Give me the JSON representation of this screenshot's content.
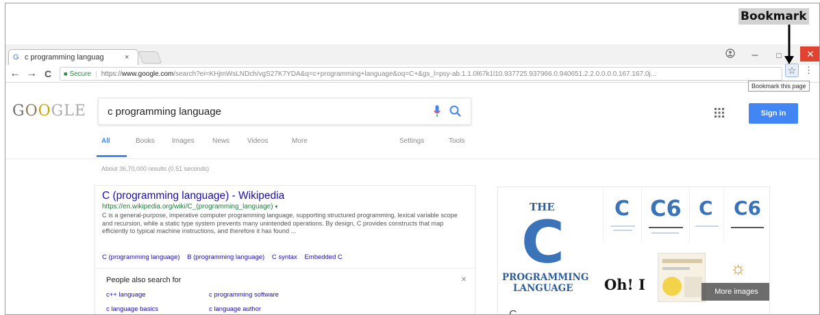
{
  "annotation": {
    "label": "Bookmark"
  },
  "browser": {
    "tab_title": "c programming languag",
    "tab_close": "×",
    "nav": {
      "back": "←",
      "forward": "→",
      "reload": "C"
    },
    "omnibox": {
      "secure_label": "Secure",
      "url_scheme": "https://",
      "url_host": "www.google.com",
      "url_rest": "/search?ei=KHjmWsLNDch/vgS27K7YDA&q=c+programming+language&oq=C+&gs_l=psy-ab.1.1.0l67k1l10.937725.937966.0.940651.2.2.0.0.0.0.167.167.0j..."
    },
    "tooltip": "Bookmark this page",
    "window_controls": {
      "minimize": "–",
      "maximize": "□",
      "close": "✕"
    },
    "profile_icon": "profile-icon"
  },
  "google": {
    "logo_text": "GOOGLE",
    "query": "c programming language",
    "signin_label": "Sign in",
    "tabs": [
      {
        "label": "All"
      },
      {
        "label": "Books"
      },
      {
        "label": "Images"
      },
      {
        "label": "News"
      },
      {
        "label": "Videos"
      },
      {
        "label": "More"
      }
    ],
    "tools": {
      "settings": "Settings",
      "tools": "Tools"
    },
    "stats": "About 36,70,000 results (0.51 seconds)"
  },
  "result": {
    "title": "C (programming language) - Wikipedia",
    "url": "https://en.wikipedia.org/wiki/C_(programming_language)",
    "url_arrow": "▾",
    "snippet": "C is a general-purpose, imperative computer programming language, supporting structured programming, lexical variable scope and recursion, while a static type system prevents many unintended operations. By design, C provides constructs that map efficiently to typical machine instructions, and therefore it has found ...",
    "sitelinks": [
      "C (programming language)",
      "B (programming language)",
      "C syntax",
      "Embedded C"
    ]
  },
  "people_also_search": {
    "title": "People also search for",
    "close": "×",
    "items": [
      {
        "label": "c++ language"
      },
      {
        "label": "c programming software"
      },
      {
        "label": "c language basics"
      },
      {
        "label": "c language author"
      }
    ]
  },
  "knowledge_panel": {
    "the": "THE",
    "big_c": "C",
    "programming": "PROGRAMMING",
    "language": "LANGUAGE",
    "oh_i": "Oh! I",
    "more_images": "More images",
    "below_letter": "C",
    "below_chevron": "⌄",
    "book_letters": [
      "C",
      "C6",
      "C",
      "C6"
    ]
  },
  "colors": {
    "accent": "#4285f4",
    "link": "#1a0dab",
    "url": "#1e7a3c",
    "close_red": "#e0432f"
  }
}
